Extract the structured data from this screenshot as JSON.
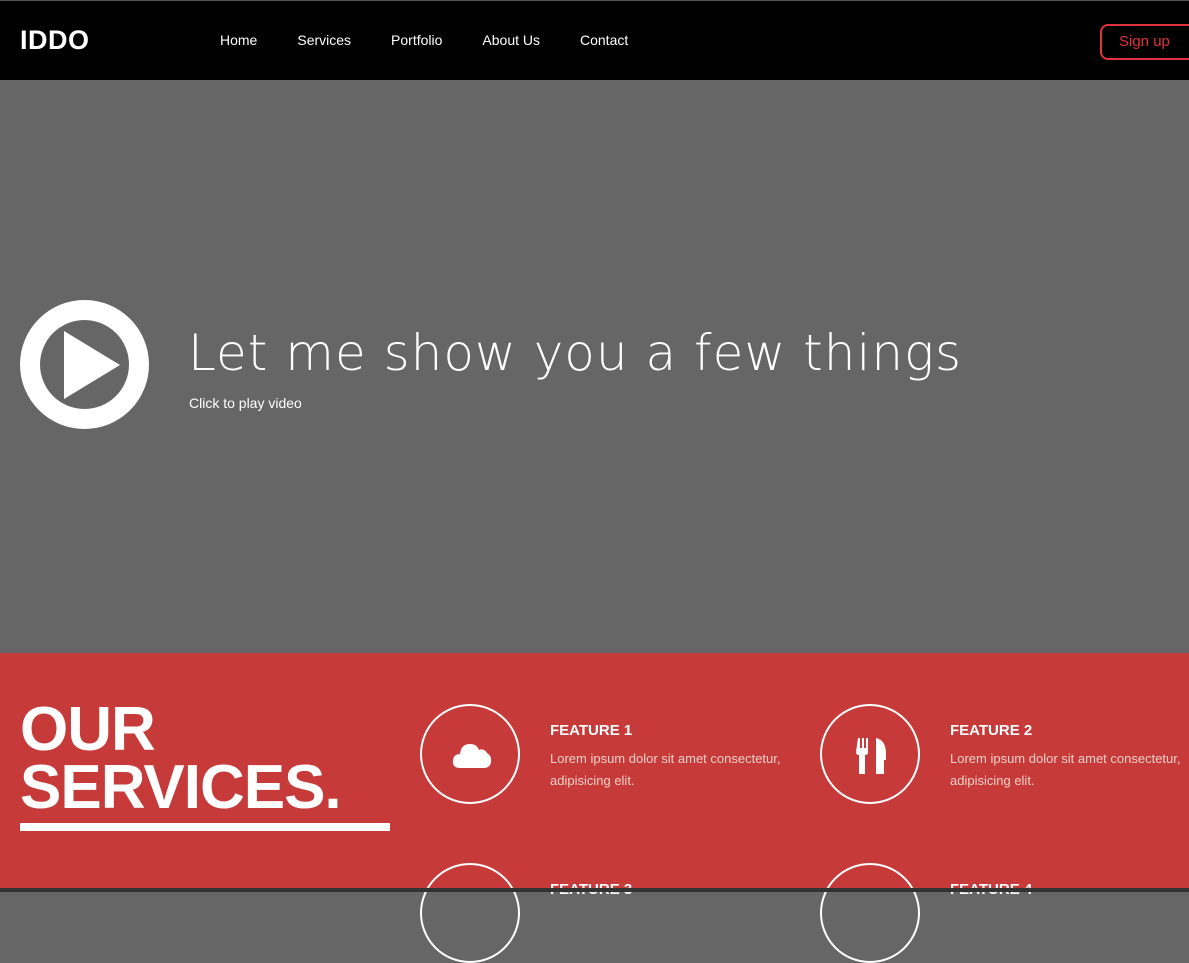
{
  "header": {
    "logo": "IDDO",
    "nav": [
      "Home",
      "Services",
      "Portfolio",
      "About Us",
      "Contact"
    ],
    "signup": "Sign up"
  },
  "hero": {
    "title": "Let me show you a few things",
    "subtitle": "Click to play video"
  },
  "services": {
    "title_line1": "OUR",
    "title_line2": "SERVICES.",
    "features": [
      {
        "title": "FEATURE 1",
        "text": "Lorem ipsum dolor sit amet consectetur, adipisicing elit.",
        "icon": "cloud-icon"
      },
      {
        "title": "FEATURE 2",
        "text": "Lorem ipsum dolor sit amet consectetur, adipisicing elit.",
        "icon": "cutlery-icon"
      },
      {
        "title": "FEATURE 3",
        "text": "",
        "icon": "feature-icon"
      },
      {
        "title": "FEATURE 4",
        "text": "",
        "icon": "feature-icon"
      }
    ]
  },
  "colors": {
    "accent": "#c63a3a",
    "signup": "#e0323c",
    "hero_bg": "#666666"
  }
}
